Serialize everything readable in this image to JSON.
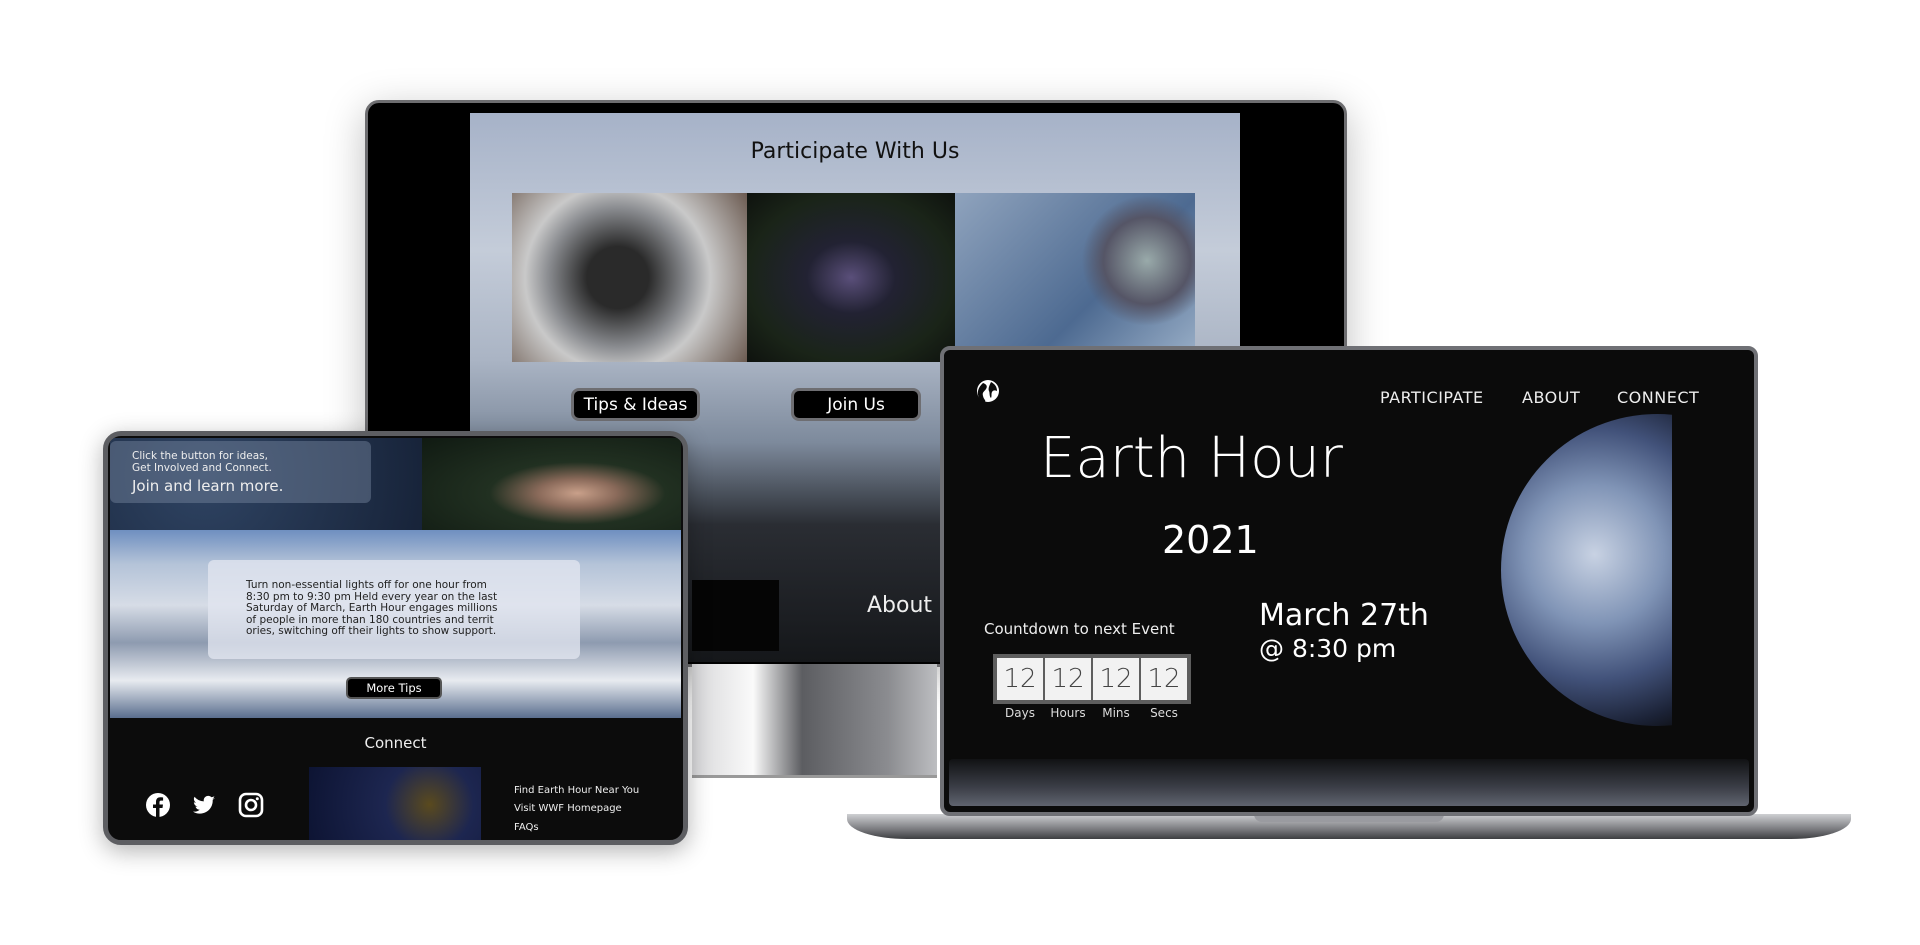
{
  "monitor": {
    "title": "Participate With Us",
    "buttons": {
      "tips": "Tips & Ideas",
      "join": "Join Us"
    },
    "about_heading": "About"
  },
  "laptop": {
    "nav": [
      "PARTICIPATE",
      "ABOUT",
      "CONNECT"
    ],
    "logo_icon": "globe-icon",
    "hero_title": "Earth Hour",
    "hero_year": "2021",
    "countdown_label": "Countdown to next Event",
    "countdown": [
      {
        "value": "12",
        "unit": "Days"
      },
      {
        "value": "12",
        "unit": "Hours"
      },
      {
        "value": "12",
        "unit": "Mins"
      },
      {
        "value": "12",
        "unit": "Secs"
      }
    ],
    "event_date": "March 27th",
    "event_time": "@ 8:30 pm"
  },
  "tablet": {
    "intro_line1": "Click the button for ideas,",
    "intro_line2": "Get Involved and Connect.",
    "intro_cta": "Join and learn more.",
    "info_lines": [
      "Turn non-essential lights off for one hour from",
      "8:30 pm to 9:30 pm Held every year on the last",
      "Saturday of March, Earth Hour engages millions",
      "of people in more than 180 countries and territ",
      "ories, switching off their lights to show support."
    ],
    "more_tips": "More Tips",
    "connect_title": "Connect",
    "social_icons": [
      "facebook-icon",
      "twitter-icon",
      "instagram-icon"
    ],
    "links": [
      "Find Earth Hour Near You",
      "Visit WWF Homepage",
      "FAQs"
    ]
  }
}
